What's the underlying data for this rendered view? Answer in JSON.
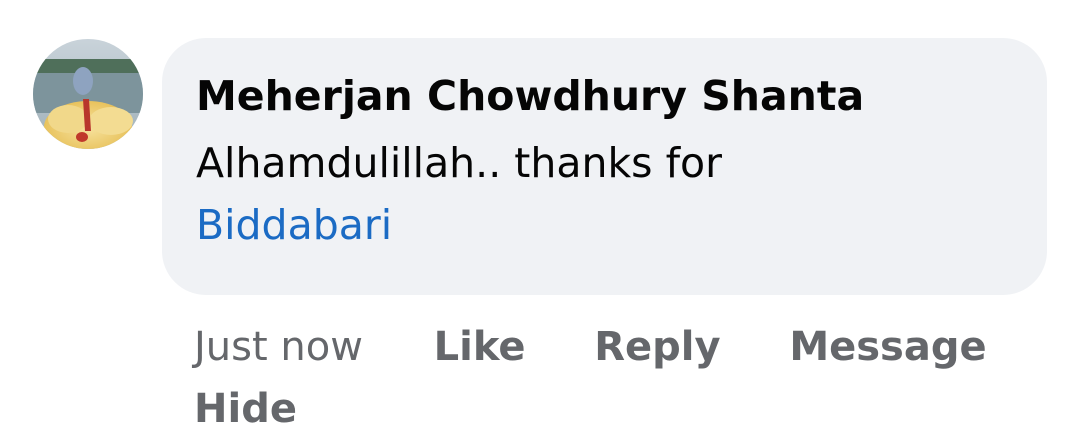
{
  "comment": {
    "author": "Meherjan Chowdhury Shanta",
    "text": "Alhamdulillah.. thanks for",
    "mention": "Biddabari",
    "timestamp": "Just now",
    "actions": {
      "like": "Like",
      "reply": "Reply",
      "message": "Message",
      "hide": "Hide"
    },
    "avatar_icon": "profile-photo"
  },
  "colors": {
    "bubble": "#f0f2f5",
    "text": "#050505",
    "mention": "#1b6bc4",
    "meta": "#65676b"
  }
}
